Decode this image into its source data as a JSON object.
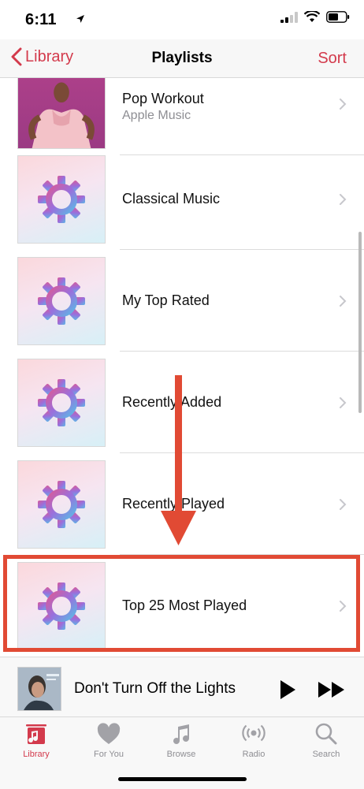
{
  "status_bar": {
    "time": "6:11"
  },
  "nav": {
    "back_label": "Library",
    "title": "Playlists",
    "action_label": "Sort"
  },
  "playlists": [
    {
      "title": "Pop Workout",
      "subtitle": "Apple Music",
      "art": "pop-workout-cover"
    },
    {
      "title": "Classical Music",
      "art": "gear-icon"
    },
    {
      "title": "My Top Rated",
      "art": "gear-icon"
    },
    {
      "title": "Recently Added",
      "art": "gear-icon"
    },
    {
      "title": "Recently Played",
      "art": "gear-icon"
    },
    {
      "title": "Top 25 Most Played",
      "art": "gear-icon"
    }
  ],
  "annotation": {
    "color": "#e14a34",
    "highlighted_item": "Top 25 Most Played"
  },
  "now_playing": {
    "title": "Don't Turn Off the Lights"
  },
  "tabs": [
    {
      "label": "Library",
      "icon": "library-icon",
      "active": true
    },
    {
      "label": "For You",
      "icon": "heart-icon",
      "active": false
    },
    {
      "label": "Browse",
      "icon": "music-note-icon",
      "active": false
    },
    {
      "label": "Radio",
      "icon": "radio-icon",
      "active": false
    },
    {
      "label": "Search",
      "icon": "search-icon",
      "active": false
    }
  ],
  "colors": {
    "accent": "#d33a4c",
    "inactive": "#8e8e93"
  }
}
